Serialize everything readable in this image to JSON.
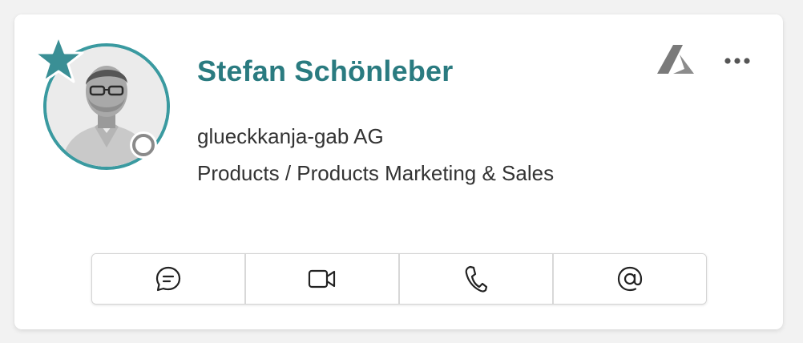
{
  "profile": {
    "name": "Stefan Schönleber",
    "company": "glueckkanja-gab AG",
    "department": "Products / Products Marketing & Sales",
    "favorite": true,
    "presence": "offline"
  },
  "header_icons": {
    "source_icon": "azure-icon",
    "more_icon": "more-icon"
  },
  "actions": [
    {
      "icon": "chat-icon"
    },
    {
      "icon": "video-icon"
    },
    {
      "icon": "phone-icon"
    },
    {
      "icon": "at-icon"
    }
  ],
  "colors": {
    "accent": "#2a7b80",
    "ring": "#3a9aa0",
    "star": "#3a8f95",
    "icon_gray": "#6b6b6b"
  }
}
